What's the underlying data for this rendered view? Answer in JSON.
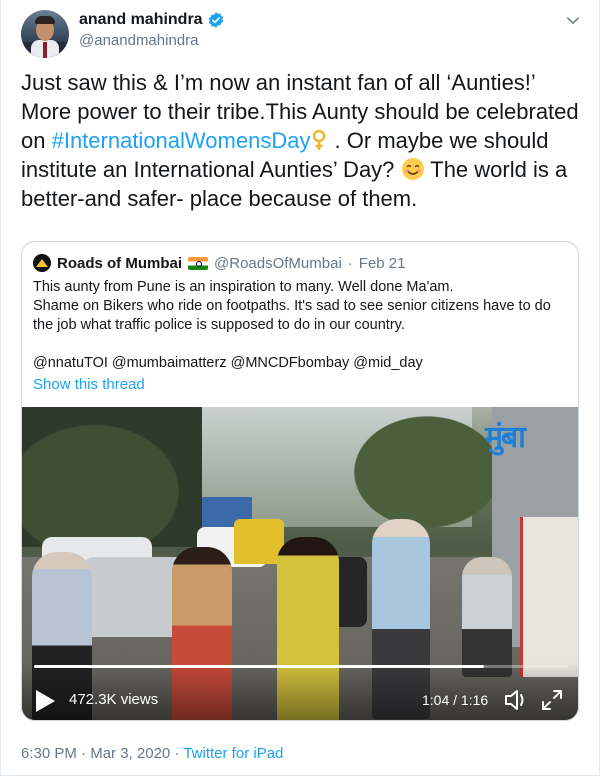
{
  "author": {
    "display_name": "anand mahindra",
    "handle": "@anandmahindra",
    "verified_icon": "verified-badge-icon"
  },
  "tweet": {
    "text_1": "Just saw this & I’m now an instant fan of all ‘Aunties!’ More power to their tribe.This Aunty should be celebrated on ",
    "hashtag": "#InternationalWomensDay",
    "text_2": " . Or maybe we should institute an International Aunties’ Day? ",
    "text_3": " The world is a better-and safer- place because of them.",
    "emojis": [
      "female-sign-icon",
      "smiling-face-icon"
    ]
  },
  "quoted": {
    "name": "Roads of Mumbai",
    "handle": "@RoadsOfMumbai",
    "separator": "·",
    "date": "Feb 21",
    "line_1": "This aunty from Pune is an inspiration to many. Well done Ma'am.",
    "line_2": "Shame on Bikers who ride on footpaths. It's sad to see senior citizens have to do the job what traffic police is supposed to do in our country.",
    "mentions": "@nnatuTOI @mumbaimatterz @MNCDFbombay @mid_day",
    "show_thread": "Show this thread",
    "video": {
      "views": "472.3K views",
      "time": "1:04 / 1:16",
      "progress_fraction": 0.842,
      "overlay_logo": "मुंबा"
    }
  },
  "footer": {
    "time": "6:30 PM",
    "separator_1": "·",
    "date": "Mar 3, 2020",
    "separator_2": "·",
    "source": "Twitter for iPad"
  },
  "colors": {
    "link": "#1da1f2",
    "text": "#14171a",
    "muted": "#657786",
    "border": "#ccd6dd"
  }
}
